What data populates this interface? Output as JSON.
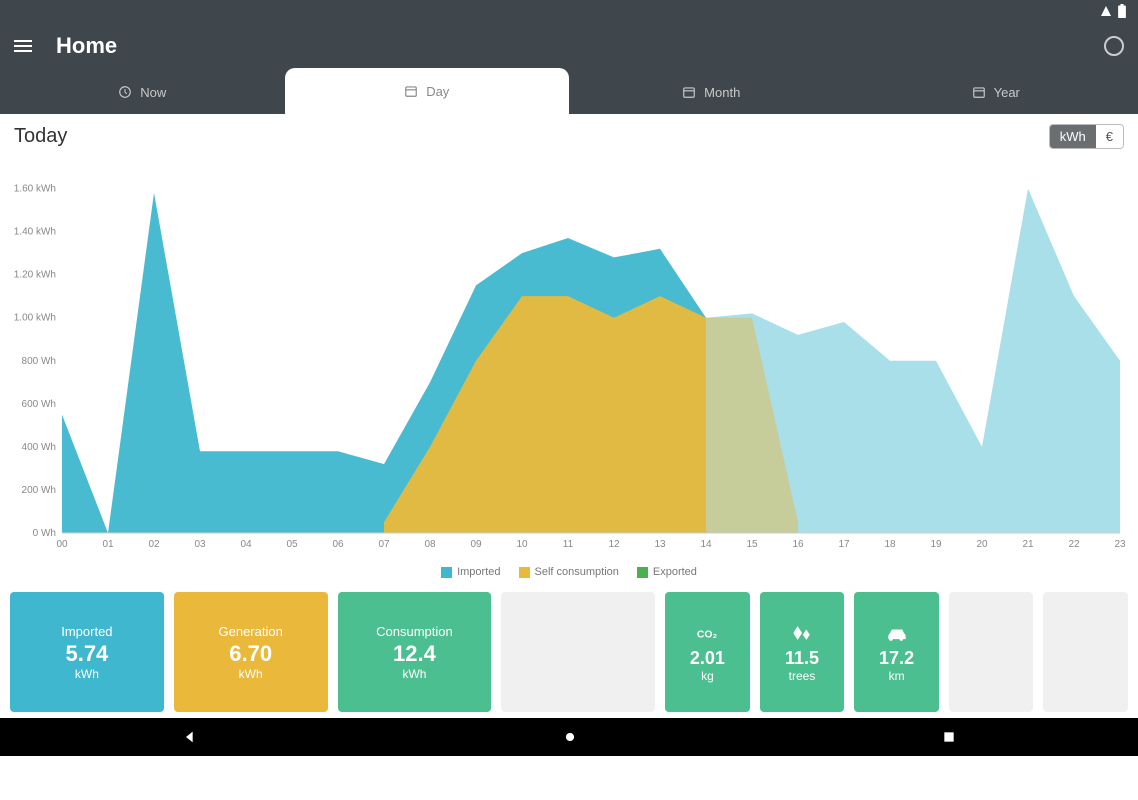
{
  "header": {
    "title": "Home"
  },
  "tabs": {
    "now": "Now",
    "day": "Day",
    "month": "Month",
    "year": "Year"
  },
  "sub": {
    "title": "Today"
  },
  "toggle": {
    "kwh": "kWh",
    "eur": "€"
  },
  "legend": {
    "imported": "Imported",
    "self": "Self consumption",
    "exported": "Exported"
  },
  "cards": {
    "imported": {
      "label": "Imported",
      "value": "5.74",
      "unit": "kWh"
    },
    "generation": {
      "label": "Generation",
      "value": "6.70",
      "unit": "kWh"
    },
    "consumption": {
      "label": "Consumption",
      "value": "12.4",
      "unit": "kWh"
    },
    "co2": {
      "value": "2.01",
      "unit": "kg"
    },
    "trees": {
      "value": "11.5",
      "unit": "trees"
    },
    "km": {
      "value": "17.2",
      "unit": "km"
    }
  },
  "chart_data": {
    "type": "area",
    "x": [
      "00",
      "01",
      "02",
      "03",
      "04",
      "05",
      "06",
      "07",
      "08",
      "09",
      "10",
      "11",
      "12",
      "13",
      "14",
      "15",
      "16",
      "17",
      "18",
      "19",
      "20",
      "21",
      "22",
      "23"
    ],
    "ylabels": [
      "0 Wh",
      "200 Wh",
      "400 Wh",
      "600 Wh",
      "800 Wh",
      "1.00 kWh",
      "1.20 kWh",
      "1.40 kWh",
      "1.60 kWh"
    ],
    "ylim": [
      0,
      1.7
    ],
    "series": [
      {
        "name": "Imported",
        "color": "#3fb7cf",
        "values": [
          0.55,
          0.0,
          1.58,
          0.38,
          0.38,
          0.38,
          0.38,
          0.32,
          0.7,
          1.15,
          1.3,
          1.37,
          1.28,
          1.32,
          1.0,
          1.02,
          0.92,
          0.98,
          0.8,
          0.8,
          0.4,
          1.6,
          1.1,
          0.8
        ]
      },
      {
        "name": "Self consumption",
        "color": "#eab93c",
        "values": [
          0,
          0,
          0,
          0,
          0,
          0,
          0,
          0.05,
          0.4,
          0.8,
          1.1,
          1.1,
          1.0,
          1.1,
          1.0,
          1.0,
          0.05,
          0,
          0,
          0,
          0,
          0,
          0,
          0
        ]
      },
      {
        "name": "Exported",
        "color": "#4caf50",
        "values": [
          0,
          0,
          0,
          0,
          0,
          0,
          0,
          0,
          0,
          0,
          0,
          0,
          0,
          0,
          0,
          0,
          0,
          0,
          0,
          0,
          0,
          0,
          0,
          0
        ]
      }
    ],
    "light_imported_from_index": 14
  }
}
